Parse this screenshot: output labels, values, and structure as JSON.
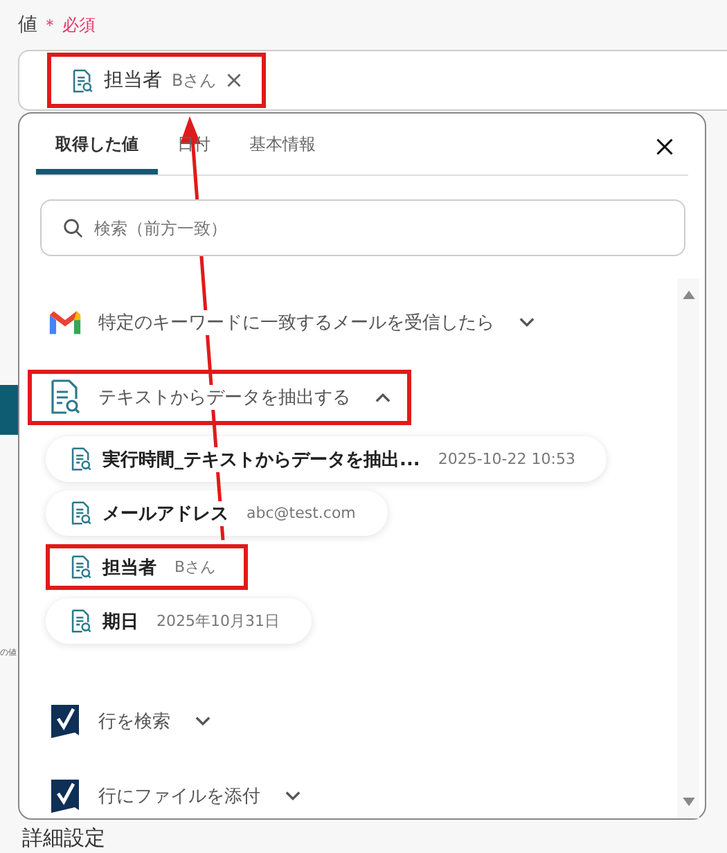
{
  "field": {
    "label": "値",
    "required_mark": "＊",
    "required": "必須",
    "chip": {
      "name": "担当者",
      "value": "Bさん",
      "highlighted": true
    }
  },
  "background": {
    "note": "の値",
    "section": "詳細設定"
  },
  "tabs": [
    {
      "label": "取得した値",
      "selected": true
    },
    {
      "label": "日付",
      "selected": false
    },
    {
      "label": "基本情報",
      "selected": false
    }
  ],
  "search": {
    "placeholder": "検索（前方一致）"
  },
  "groups": [
    {
      "kind": "gmail",
      "title": "特定のキーワードに一致するメールを受信したら",
      "expanded": false,
      "highlighted": false
    },
    {
      "kind": "extract",
      "title": "テキストからデータを抽出する",
      "expanded": true,
      "highlighted": true,
      "items": [
        {
          "name": "実行時間_テキストからデータを抽出...",
          "value": "2025-10-22 10:53",
          "highlighted": false
        },
        {
          "name": "メールアドレス",
          "value": "abc@test.com",
          "highlighted": false
        },
        {
          "name": "担当者",
          "value": "Bさん",
          "highlighted": true
        },
        {
          "name": "期日",
          "value": "2025年10月31日",
          "highlighted": false
        }
      ]
    },
    {
      "kind": "sheet",
      "title": "行を検索",
      "expanded": false,
      "highlighted": false
    },
    {
      "kind": "sheet",
      "title": "行にファイルを添付",
      "expanded": false,
      "highlighted": false
    }
  ],
  "annotation": {
    "arrow": true
  }
}
